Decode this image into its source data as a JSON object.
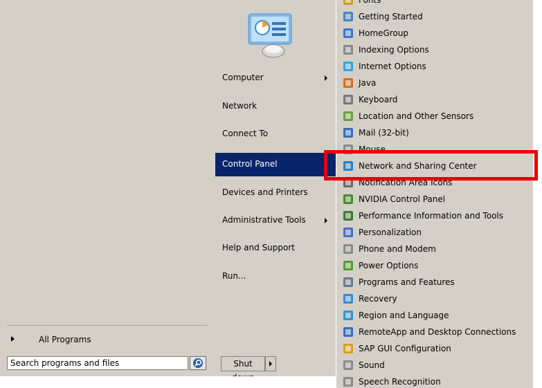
{
  "all_programs": {
    "label": "All Programs"
  },
  "search": {
    "value": "Search programs and files",
    "icon": "search-icon"
  },
  "places": [
    {
      "label": "Computer",
      "submenu": true,
      "selected": false
    },
    {
      "label": "Network",
      "submenu": false,
      "selected": false
    },
    {
      "label": "Connect To",
      "submenu": false,
      "selected": false
    },
    {
      "label": "Control Panel",
      "submenu": false,
      "selected": true
    },
    {
      "label": "Devices and Printers",
      "submenu": false,
      "selected": false
    },
    {
      "label": "Administrative Tools",
      "submenu": true,
      "selected": false
    },
    {
      "label": "Help and Support",
      "submenu": false,
      "selected": false
    },
    {
      "label": "Run...",
      "submenu": false,
      "selected": false
    }
  ],
  "shutdown": {
    "label": "Shut down"
  },
  "control_panel_items": [
    {
      "label": "Fonts",
      "icon": "fonts-icon",
      "color": "#c8a030"
    },
    {
      "label": "Getting Started",
      "icon": "getting-started-icon",
      "color": "#4a84c4"
    },
    {
      "label": "HomeGroup",
      "icon": "homegroup-icon",
      "color": "#3a78c8"
    },
    {
      "label": "Indexing Options",
      "icon": "indexing-options-icon",
      "color": "#8a8a8a"
    },
    {
      "label": "Internet Options",
      "icon": "internet-options-icon",
      "color": "#3aa0d8"
    },
    {
      "label": "Java",
      "icon": "java-icon",
      "color": "#d07020"
    },
    {
      "label": "Keyboard",
      "icon": "keyboard-icon",
      "color": "#7a7a7a"
    },
    {
      "label": "Location and Other Sensors",
      "icon": "location-sensors-icon",
      "color": "#6aa040"
    },
    {
      "label": "Mail (32-bit)",
      "icon": "mail-icon",
      "color": "#3a6ab8"
    },
    {
      "label": "Mouse",
      "icon": "mouse-icon",
      "color": "#8a8a8a"
    },
    {
      "label": "Network and Sharing Center",
      "icon": "network-sharing-icon",
      "color": "#2a80c0"
    },
    {
      "label": "Notification Area Icons",
      "icon": "notification-area-icon",
      "color": "#6a6a6a"
    },
    {
      "label": "NVIDIA Control Panel",
      "icon": "nvidia-icon",
      "color": "#4a8a2a"
    },
    {
      "label": "Performance Information and Tools",
      "icon": "performance-icon",
      "color": "#3a7a3a"
    },
    {
      "label": "Personalization",
      "icon": "personalization-icon",
      "color": "#4a70c0"
    },
    {
      "label": "Phone and Modem",
      "icon": "phone-modem-icon",
      "color": "#8a8a8a"
    },
    {
      "label": "Power Options",
      "icon": "power-options-icon",
      "color": "#5a9a3a"
    },
    {
      "label": "Programs and Features",
      "icon": "programs-features-icon",
      "color": "#6a7a8a"
    },
    {
      "label": "Recovery",
      "icon": "recovery-icon",
      "color": "#3a8ad0"
    },
    {
      "label": "Region and Language",
      "icon": "region-language-icon",
      "color": "#3a90c0"
    },
    {
      "label": "RemoteApp and Desktop Connections",
      "icon": "remoteapp-icon",
      "color": "#3a70b8"
    },
    {
      "label": "SAP GUI Configuration",
      "icon": "sap-gui-icon",
      "color": "#d8a020"
    },
    {
      "label": "Sound",
      "icon": "sound-icon",
      "color": "#8a8a8a"
    },
    {
      "label": "Speech Recognition",
      "icon": "speech-recognition-icon",
      "color": "#8a8a8a"
    }
  ],
  "highlight_color": "#e8000b",
  "selection_color": "#0a246a"
}
